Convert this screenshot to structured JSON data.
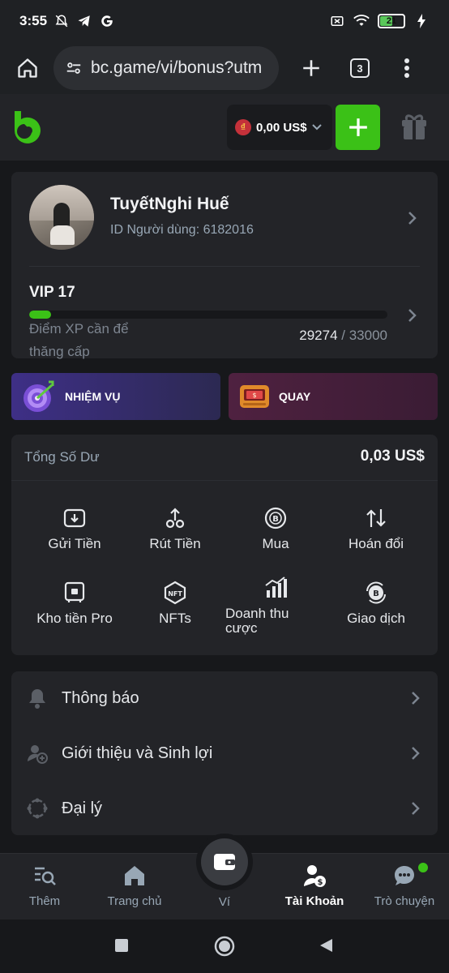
{
  "status_bar": {
    "time": "3:55",
    "battery": "21"
  },
  "browser": {
    "url": "bc.game/vi/bonus?utm",
    "tab_count": "3"
  },
  "header": {
    "balance": "0,00 US$",
    "coin_symbol": "₫"
  },
  "profile": {
    "name": "TuyếtNghi Huế",
    "user_id": "ID Người dùng: 6182016",
    "vip_level": "VIP 17",
    "xp_label": "Điểm XP cần để thăng cấp",
    "xp_current": "29274",
    "xp_separator": " / ",
    "xp_total": "33000",
    "xp_progress": 0.06
  },
  "promos": {
    "mission_label": "NHIỆM VỤ",
    "spin_label": "QUAY"
  },
  "wallet": {
    "total_label": "Tổng Số Dư",
    "total_value": "0,03 US$",
    "actions": [
      {
        "label": "Gửi Tiền",
        "icon": "deposit-icon"
      },
      {
        "label": "Rút Tiền",
        "icon": "withdraw-icon"
      },
      {
        "label": "Mua",
        "icon": "buy-crypto-icon"
      },
      {
        "label": "Hoán đổi",
        "icon": "swap-icon"
      },
      {
        "label": "Kho tiền Pro",
        "icon": "vault-icon"
      },
      {
        "label": "NFTs",
        "icon": "nft-icon"
      },
      {
        "label": "Doanh thu cược",
        "icon": "bar-chart-icon"
      },
      {
        "label": "Giao dịch",
        "icon": "transactions-icon"
      }
    ]
  },
  "menu": {
    "items": [
      {
        "label": "Thông báo",
        "icon": "bell-icon"
      },
      {
        "label": "Giới thiệu và Sinh lợi",
        "icon": "referral-icon"
      },
      {
        "label": "Đại lý",
        "icon": "agent-icon"
      }
    ]
  },
  "bottom_nav": {
    "items": [
      {
        "label": "Thêm",
        "icon": "search-list-icon"
      },
      {
        "label": "Trang chủ",
        "icon": "home-icon"
      },
      {
        "label": "Ví",
        "icon": "wallet-icon"
      },
      {
        "label": "Tài Khoản",
        "icon": "account-icon",
        "active": true
      },
      {
        "label": "Trò chuyện",
        "icon": "chat-icon"
      }
    ]
  },
  "colors": {
    "accent": "#3bc117",
    "background": "#17181b",
    "card": "#232428"
  }
}
